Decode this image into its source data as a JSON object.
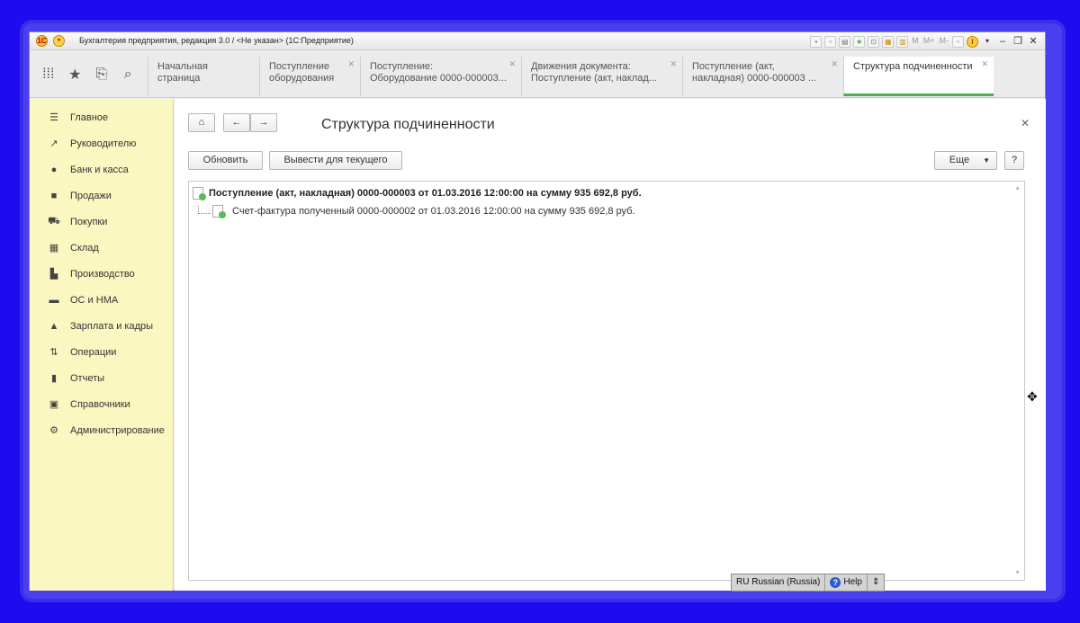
{
  "titlebar": {
    "logo_text": "1С",
    "title": "Бухгалтерия предприятия, редакция 3.0 / <Не указан> (1С:Предприятие)",
    "m_labels": [
      "M",
      "M+",
      "M-"
    ]
  },
  "tabs": [
    {
      "line1": "Начальная страница",
      "line2": ""
    },
    {
      "line1": "Поступление",
      "line2": "оборудования"
    },
    {
      "line1": "Поступление:",
      "line2": "Оборудование 0000-000003..."
    },
    {
      "line1": "Движения документа:",
      "line2": "Поступление (акт, наклад..."
    },
    {
      "line1": "Поступление (акт,",
      "line2": "накладная) 0000-000003 ..."
    },
    {
      "line1": "Структура подчиненности",
      "line2": ""
    }
  ],
  "sidebar": {
    "items": [
      {
        "label": "Главное",
        "icon": "menu-icon"
      },
      {
        "label": "Руководителю",
        "icon": "trend-icon"
      },
      {
        "label": "Банк и касса",
        "icon": "ruble-icon"
      },
      {
        "label": "Продажи",
        "icon": "bag-icon"
      },
      {
        "label": "Покупки",
        "icon": "cart-icon"
      },
      {
        "label": "Склад",
        "icon": "warehouse-icon"
      },
      {
        "label": "Производство",
        "icon": "factory-icon"
      },
      {
        "label": "ОС и НМА",
        "icon": "truck-icon"
      },
      {
        "label": "Зарплата и кадры",
        "icon": "person-icon"
      },
      {
        "label": "Операции",
        "icon": "operations-icon"
      },
      {
        "label": "Отчеты",
        "icon": "chart-icon"
      },
      {
        "label": "Справочники",
        "icon": "book-icon"
      },
      {
        "label": "Администрирование",
        "icon": "gear-icon"
      }
    ]
  },
  "form": {
    "title": "Структура подчиненности",
    "refresh_label": "Обновить",
    "output_current_label": "Вывести для текущего",
    "more_label": "Еще",
    "help_label": "?"
  },
  "tree": {
    "root": "Поступление (акт, накладная) 0000-000003 от 01.03.2016 12:00:00 на сумму 935 692,8 руб.",
    "child": "Счет-фактура полученный 0000-000002 от 01.03.2016 12:00:00 на сумму 935 692,8 руб."
  },
  "langbar": {
    "language": "RU Russian (Russia)",
    "help": "Help"
  },
  "colors": {
    "desktop": "#1c0cee",
    "sidebar": "#fbf7c1",
    "active_tab_accent": "#4caf50"
  }
}
